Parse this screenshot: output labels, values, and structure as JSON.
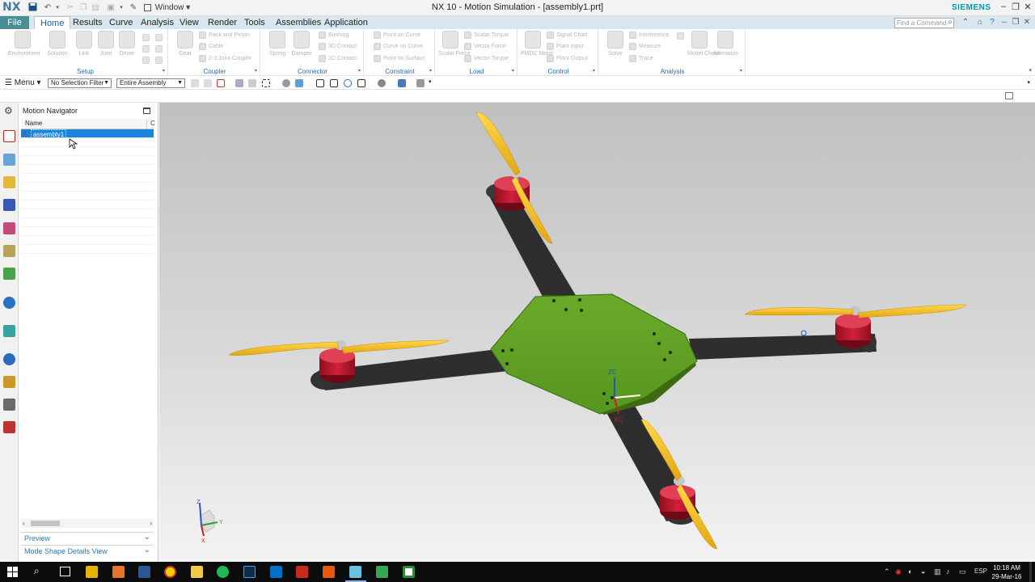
{
  "app": {
    "logo": "NX",
    "title": "NX 10 - Motion Simulation - [assembly1.prt]",
    "window_label": "Window ▾",
    "brand": "SIEMENS",
    "command_search_placeholder": "Find a Command"
  },
  "menu_tabs": {
    "file": "File",
    "home": "Home",
    "results": "Results",
    "curve": "Curve",
    "analysis": "Analysis",
    "view": "View",
    "render": "Render",
    "tools": "Tools",
    "assemblies": "Assemblies",
    "application": "Application"
  },
  "ribbon": {
    "setup": {
      "label": "Setup",
      "environment": "Environment",
      "solution": "Solution",
      "link": "Link",
      "joint": "Joint",
      "driver": "Driver"
    },
    "coupler": {
      "label": "Coupler",
      "gear": "Gear",
      "rack_and_pinion": "Rack and Pinion",
      "cable": "Cable",
      "joint_coupler": "2-3 Joint Coupler"
    },
    "connector": {
      "label": "Connector",
      "spring": "Spring",
      "damper": "Damper",
      "bushing": "Bushing",
      "contact_3d": "3D Contact",
      "contact_2d": "2D Contact"
    },
    "constraint": {
      "label": "Constraint",
      "point_on_curve": "Point on Curve",
      "curve_on_curve": "Curve on Curve",
      "point_on_surface": "Point on Surface"
    },
    "load": {
      "label": "Load",
      "scalar_force": "Scalar Force",
      "scalar_torque": "Scalar Torque",
      "vector_force": "Vector Force",
      "vector_torque": "Vector Torque"
    },
    "control": {
      "label": "Control",
      "pmdc_motor": "PMDC Motor",
      "signal_chart": "Signal Chart",
      "plant_input": "Plant Input",
      "plant_output": "Plant Output"
    },
    "analysis": {
      "label": "Analysis",
      "solve": "Solve",
      "interference": "Interference",
      "measure": "Measure",
      "trace": "Trace",
      "model_check": "Model Check",
      "animation": "Animation"
    }
  },
  "toolbar": {
    "menu": "Menu ▾",
    "selection_filter": "No Selection Filter",
    "assembly_scope": "Entire Assembly"
  },
  "navigator": {
    "title": "Motion Navigator",
    "col_name": "Name",
    "col_c": "C",
    "root_node": "assembly1",
    "preview": "Preview",
    "mode_shape": "Mode Shape Details View"
  },
  "viewport": {
    "wcs_zc": "ZC",
    "wcs_xc": "XC",
    "triad_z": "Z",
    "triad_y": "Y",
    "triad_x": "X"
  },
  "taskbar": {
    "language": "ESP",
    "time": "10:18 AM",
    "date": "29-Mar-16"
  }
}
